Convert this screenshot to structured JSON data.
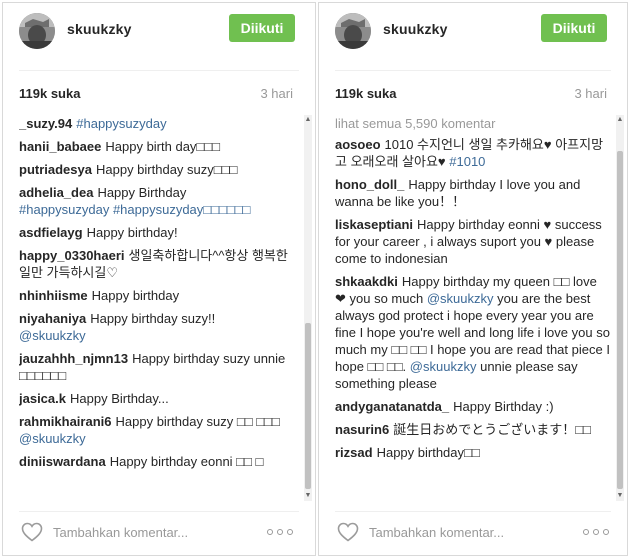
{
  "colors": {
    "follow_bg": "#70c050",
    "link": "#3d6a97",
    "muted": "#999999"
  },
  "left": {
    "username": "skuukzky",
    "follow_label": "Diikuti",
    "likes": "119k suka",
    "time": "3 hari",
    "comment_placeholder": "Tambahkan komentar...",
    "comments": [
      {
        "user": "_suzy.94",
        "text": "",
        "tag": "#happysuzyday"
      },
      {
        "user": "hanii_babaee",
        "text": "Happy birth day□□□"
      },
      {
        "user": "putriadesya",
        "text": "Happy birthday suzy□□□"
      },
      {
        "user": "adhelia_dea",
        "text": "Happy Birthday",
        "tag": "#happysuzyday #happysuzyday□□□□□□"
      },
      {
        "user": "asdfielayg",
        "text": "Happy birthday!"
      },
      {
        "user": "happy_0330haeri",
        "text": "생일축하합니다^^항상 행복한 일만 가득하시길♡"
      },
      {
        "user": "nhinhiisme",
        "text": "Happy birthday"
      },
      {
        "user": "niyahaniya",
        "text": "Happy birthday suzy!!",
        "mention": "@skuukzky"
      },
      {
        "user": "jauzahhh_njmn13",
        "text": "Happy birthday suzy unnie □□□□□□"
      },
      {
        "user": "jasica.k",
        "text": "Happy Birthday..."
      },
      {
        "user": "rahmikhairani6",
        "text": "Happy birthday suzy □□ □□□",
        "mention": "@skuukzky"
      },
      {
        "user": "diniiswardana",
        "text": "Happy birthday eonni □□ □"
      }
    ]
  },
  "right": {
    "username": "skuukzky",
    "follow_label": "Diikuti",
    "likes": "119k suka",
    "time": "3 hari",
    "load_more": "lihat semua 5,590 komentar",
    "comment_placeholder": "Tambahkan komentar...",
    "comments": [
      {
        "user": "aosoeo",
        "text": "1010 수지언니 생일 추카해요♥ 아프지망고 오래오래 살아요♥",
        "tag": "#1010"
      },
      {
        "user": "hono_doll_",
        "text": "Happy birthday I love you and wanna be like you！！"
      },
      {
        "user": "liskaseptiani",
        "text": "Happy birthday eonni ♥ success for your career , i always suport you ♥ please come to indonesian"
      },
      {
        "user": "shkaakdki",
        "text": "Happy birthday my queen □□ love ❤ you so much",
        "mention": "@skuukzky",
        "text2": "you are the best always god protect i hope every year you are fine I hope you're well and long life i love you so much my □□ □□ I hope you are read that piece I hope □□ □□.",
        "mention2": "@skuukzky",
        "text3": "unnie please say something please"
      },
      {
        "user": "andyganatanatda_",
        "text": "Happy Birthday :)"
      },
      {
        "user": "nasurin6",
        "text": "誕生日おめでとうございます！□□"
      },
      {
        "user": "rizsad",
        "text": "Happy birthday□□"
      }
    ]
  }
}
